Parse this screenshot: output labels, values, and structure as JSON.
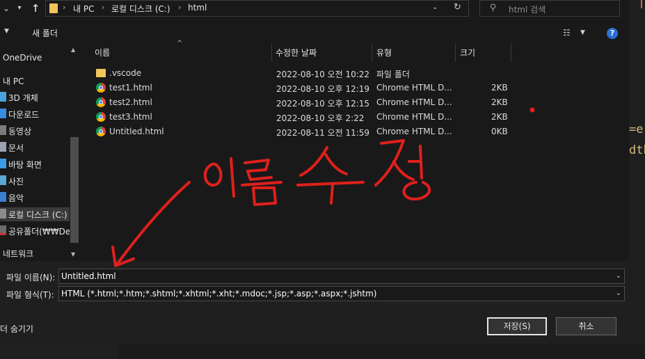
{
  "window": {
    "address_crumbs": [
      "내 PC",
      "로컬 디스크 (C:)",
      "html"
    ],
    "search_placeholder": "html 검색"
  },
  "toolbar": {
    "new_folder_label": "새 폴더",
    "help_label": "?"
  },
  "sidebar": {
    "items": [
      {
        "label": "OneDrive",
        "icon": "cloud-icon"
      },
      {
        "label": "내 PC",
        "icon": "computer-icon"
      },
      {
        "label": "3D 개체",
        "icon": "3d-objects-icon"
      },
      {
        "label": "다운로드",
        "icon": "download-icon"
      },
      {
        "label": "동영상",
        "icon": "video-icon"
      },
      {
        "label": "문서",
        "icon": "document-icon"
      },
      {
        "label": "바탕 화면",
        "icon": "desktop-icon"
      },
      {
        "label": "사진",
        "icon": "pictures-icon"
      },
      {
        "label": "음악",
        "icon": "music-icon"
      },
      {
        "label": "로컬 디스크 (C:)",
        "icon": "drive-icon"
      },
      {
        "label": "공유폴더(₩₩De",
        "icon": "network-drive-icon"
      },
      {
        "label": "네트워크",
        "icon": "network-icon"
      }
    ],
    "selected_index": 9
  },
  "columns": {
    "name": "이름",
    "modified": "수정한 날짜",
    "type": "유형",
    "size": "크기"
  },
  "files": [
    {
      "name": ".vscode",
      "modified": "2022-08-10 오전 10:22",
      "type": "파일 폴더",
      "size": "",
      "icon": "folder-icon"
    },
    {
      "name": "test1.html",
      "modified": "2022-08-10 오후 12:19",
      "type": "Chrome HTML D...",
      "size": "2KB",
      "icon": "chrome-icon"
    },
    {
      "name": "test2.html",
      "modified": "2022-08-10 오후 12:15",
      "type": "Chrome HTML D...",
      "size": "2KB",
      "icon": "chrome-icon"
    },
    {
      "name": "test3.html",
      "modified": "2022-08-10 오후 2:22",
      "type": "Chrome HTML D...",
      "size": "2KB",
      "icon": "chrome-icon"
    },
    {
      "name": "Untitled.html",
      "modified": "2022-08-11 오전 11:59",
      "type": "Chrome HTML D...",
      "size": "0KB",
      "icon": "chrome-icon"
    }
  ],
  "form": {
    "filename_label": "파일 이름(N):",
    "filename_value": "Untitled.html",
    "filetype_label": "파일 형식(T):",
    "filetype_value": "HTML (*.html;*.htm;*.shtml;*.xhtml;*.xht;*.mdoc;*.jsp;*.asp;*.aspx;*.jshtm)"
  },
  "footer": {
    "hide_folders_label": "더 숨기기",
    "save_label": "저장(S)",
    "cancel_label": "취소"
  },
  "annotation": {
    "text": "이름수정",
    "color": "#e0201c"
  },
  "editor_fragments": [
    "=e(",
    "dth"
  ]
}
